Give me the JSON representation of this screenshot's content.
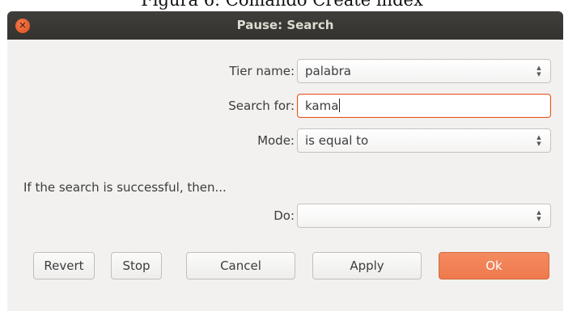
{
  "caption": "Figura 6: Comando Create index",
  "window": {
    "title": "Pause: Search"
  },
  "form": {
    "tier_name_label": "Tier name:",
    "tier_name_value": "palabra",
    "search_for_label": "Search for:",
    "search_for_value": "kama",
    "mode_label": "Mode:",
    "mode_value": "is equal to",
    "section_text": "If the search is successful, then...",
    "do_label": "Do:",
    "do_value": ""
  },
  "buttons": {
    "revert": "Revert",
    "stop": "Stop",
    "cancel": "Cancel",
    "apply": "Apply",
    "ok": "Ok"
  },
  "icons": {
    "close": "close-icon",
    "spinner": "up-down-arrows-icon"
  },
  "colors": {
    "accent": "#e95420",
    "default_button": "#f08050",
    "titlebar": "#3c3b37",
    "window_bg": "#f2f1f0"
  }
}
